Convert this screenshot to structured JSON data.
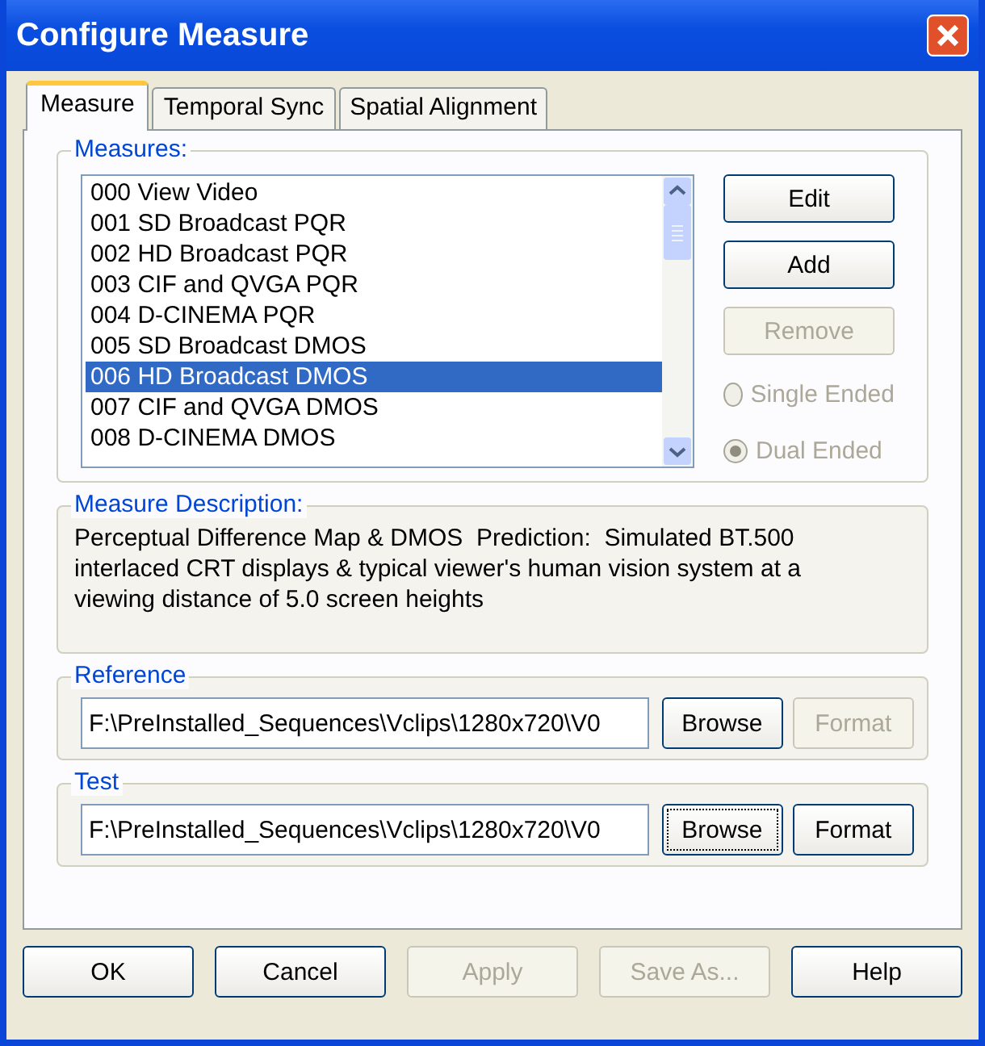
{
  "window": {
    "title": "Configure Measure"
  },
  "tabs": [
    {
      "label": "Measure",
      "selected": true
    },
    {
      "label": "Temporal Sync",
      "selected": false
    },
    {
      "label": "Spatial Alignment",
      "selected": false
    }
  ],
  "measures": {
    "label": "Measures:",
    "items": [
      {
        "text": "000 View Video",
        "selected": false
      },
      {
        "text": "001 SD Broadcast PQR",
        "selected": false
      },
      {
        "text": "002 HD Broadcast PQR",
        "selected": false
      },
      {
        "text": "003 CIF and QVGA PQR",
        "selected": false
      },
      {
        "text": "004 D-CINEMA PQR",
        "selected": false
      },
      {
        "text": "005 SD Broadcast DMOS",
        "selected": false
      },
      {
        "text": "006 HD Broadcast DMOS",
        "selected": true
      },
      {
        "text": "007 CIF and QVGA DMOS",
        "selected": false
      },
      {
        "text": "008 D-CINEMA DMOS",
        "selected": false
      }
    ],
    "buttons": [
      {
        "label": "Edit",
        "disabled": false
      },
      {
        "label": "Add",
        "disabled": false
      },
      {
        "label": "Remove",
        "disabled": true
      }
    ],
    "modes": [
      {
        "label": "Single Ended",
        "selected": false,
        "disabled": true
      },
      {
        "label": "Dual Ended",
        "selected": true,
        "disabled": true
      }
    ]
  },
  "description": {
    "label": "Measure Description:",
    "text": "Perceptual Difference Map & DMOS  Prediction:  Simulated BT.500 interlaced CRT displays & typical viewer's human vision system at a viewing distance of 5.0 screen heights"
  },
  "files": [
    {
      "label": "Reference",
      "value": "F:\\PreInstalled_Sequences\\Vclips\\1280x720\\V0",
      "buttons": [
        {
          "label": "Browse",
          "disabled": false,
          "focused": false
        },
        {
          "label": "Format",
          "disabled": true,
          "focused": false
        }
      ]
    },
    {
      "label": "Test",
      "value": "F:\\PreInstalled_Sequences\\Vclips\\1280x720\\V0",
      "buttons": [
        {
          "label": "Browse",
          "disabled": false,
          "focused": true
        },
        {
          "label": "Format",
          "disabled": false,
          "focused": false
        }
      ]
    }
  ],
  "footer": [
    {
      "label": "OK",
      "disabled": false
    },
    {
      "label": "Cancel",
      "disabled": false
    },
    {
      "label": "Apply",
      "disabled": true
    },
    {
      "label": "Save As...",
      "disabled": true
    },
    {
      "label": "Help",
      "disabled": false
    }
  ]
}
